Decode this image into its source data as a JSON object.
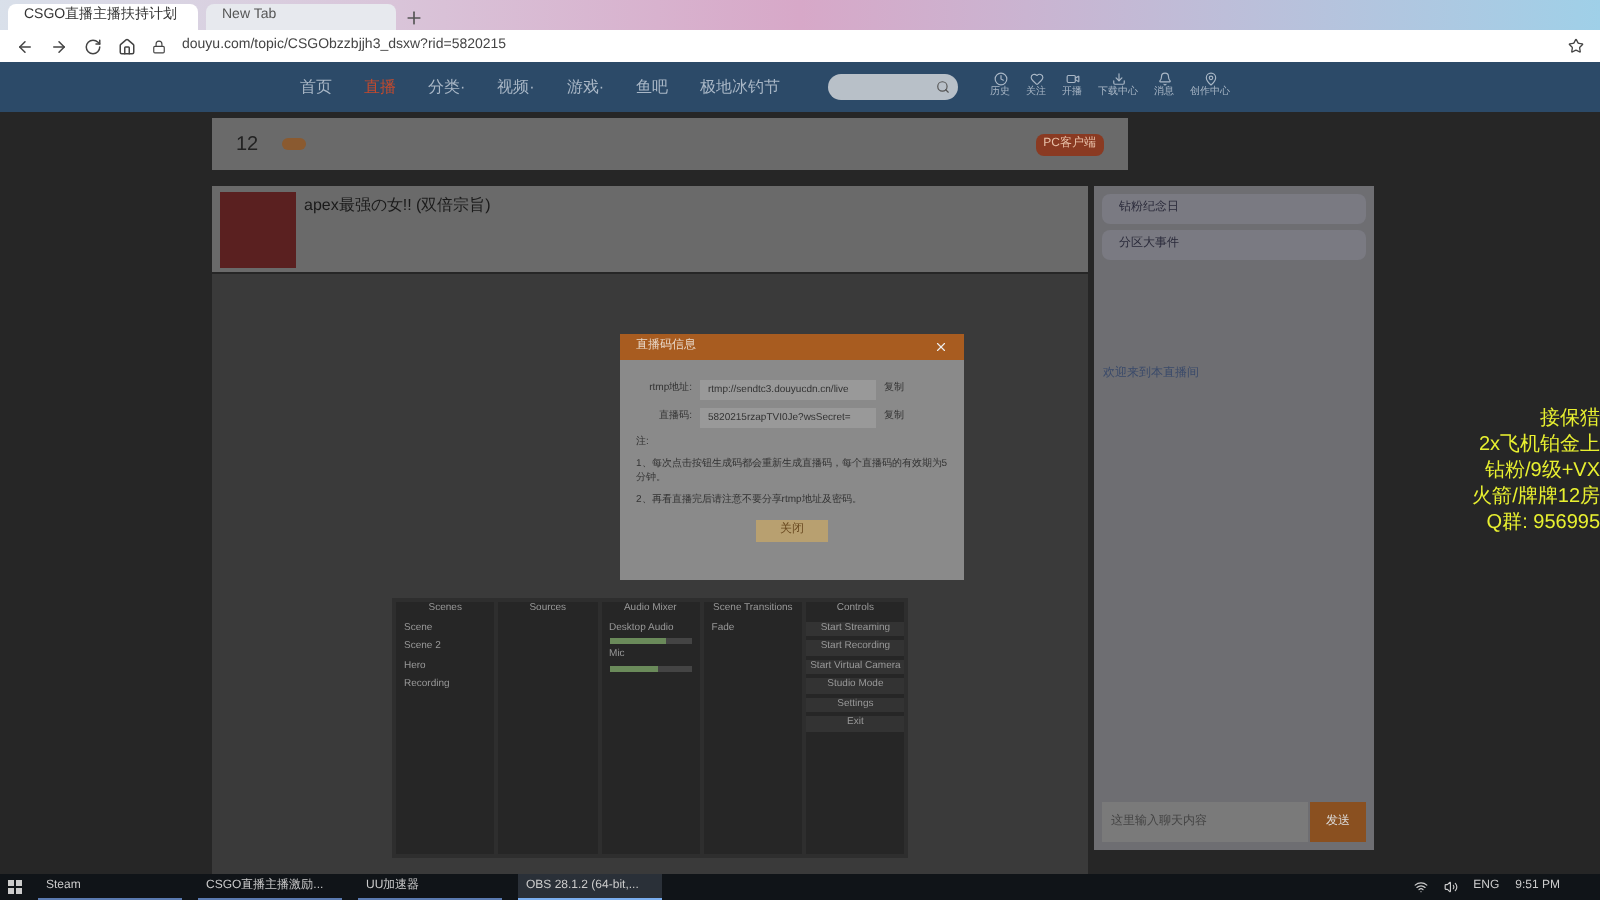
{
  "browser": {
    "tabs": [
      {
        "label": "CSGO直播主播扶持计划",
        "selected": true
      },
      {
        "label": "New Tab",
        "selected": false
      }
    ],
    "url": "douyu.com/topic/CSGObzzbjjh3_dsxw?rid=5820215"
  },
  "site_nav": {
    "items": [
      {
        "label": "首页",
        "selected": false
      },
      {
        "label": "直播",
        "selected": true
      },
      {
        "label": "分类·",
        "selected": false
      },
      {
        "label": "视频·",
        "selected": false
      },
      {
        "label": "游戏·",
        "selected": false
      },
      {
        "label": "鱼吧",
        "selected": false
      },
      {
        "label": "极地冰钓节",
        "selected": false
      }
    ],
    "tools": [
      "历史",
      "关注",
      "开播",
      "下载中心",
      "消息",
      "创作中心"
    ]
  },
  "sub_bar": {
    "count": "12",
    "client_button": "PC客户端"
  },
  "streamer": {
    "title": "apex最强の女!! (双倍宗旨)"
  },
  "dialog": {
    "title": "直播码信息",
    "fields": [
      {
        "label": "rtmp地址:",
        "value": "rtmp://sendtc3.douyucdn.cn/live",
        "action": "复制"
      },
      {
        "label": "直播码:",
        "value": "5820215rzapTVI0Je?wsSecret=",
        "action": "复制"
      }
    ],
    "notes": [
      "注:",
      "1、每次点击按钮生成码都会重新生成直播码，每个直播码的有效期为5分钟。",
      "2、再看直播完后请注意不要分享rtmp地址及密码。"
    ],
    "close_button": "关闭"
  },
  "obs": {
    "docks": [
      "Scenes",
      "Sources",
      "Audio Mixer",
      "Scene Transitions",
      "Controls"
    ],
    "scenes": [
      {
        "label": "Scene",
        "selected": false
      },
      {
        "label": "Scene 2",
        "selected": false
      },
      {
        "label": "Hero",
        "selected": false
      },
      {
        "label": "Recording",
        "selected": false
      }
    ],
    "mixer": [
      {
        "name": "Desktop Audio",
        "level": 0.7
      },
      {
        "name": "Mic",
        "level": 0.6
      }
    ],
    "transition": "Fade",
    "controls": [
      "Start Streaming",
      "Start Recording",
      "Start Virtual Camera",
      "Studio Mode",
      "Settings",
      "Exit"
    ]
  },
  "chat": {
    "events": [
      "钻粉纪念日",
      "分区大事件"
    ],
    "welcome": "欢迎来到本直播间",
    "input": {
      "placeholder": "这里输入聊天内容"
    },
    "send_button": "发送"
  },
  "overlay_text": [
    "接保猎",
    "2x飞机铂金上",
    "钻粉/9级+VX",
    "火箭/牌牌12房",
    "Q群: 956995"
  ],
  "taskbar": {
    "apps": [
      {
        "label": "Steam",
        "selected": false
      },
      {
        "label": "CSGO直播主播激励...",
        "selected": false
      },
      {
        "label": "UU加速器",
        "selected": false
      },
      {
        "label": "OBS 28.1.2 (64-bit,...",
        "selected": true
      }
    ],
    "language": "ENG",
    "time": "9:51 PM"
  }
}
